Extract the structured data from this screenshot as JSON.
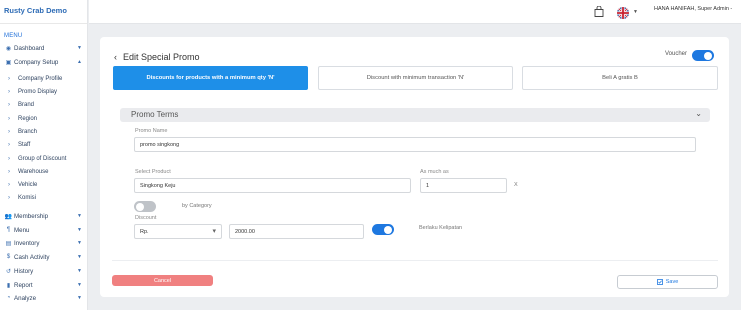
{
  "app": {
    "brand": "Rusty Crab Demo"
  },
  "sidebar": {
    "menu_title": "MENU",
    "items": [
      {
        "label": "Dashboard",
        "icon": "dashboard-icon"
      },
      {
        "label": "Company Setup",
        "icon": "company-icon"
      },
      {
        "label": "Membership",
        "icon": "users-icon"
      },
      {
        "label": "Menu",
        "icon": "menu-icon"
      },
      {
        "label": "Inventory",
        "icon": "inventory-icon"
      },
      {
        "label": "Cash Activity",
        "icon": "cash-icon"
      },
      {
        "label": "History",
        "icon": "history-icon"
      },
      {
        "label": "Report",
        "icon": "report-icon"
      },
      {
        "label": "Analyze",
        "icon": "analyze-icon"
      }
    ],
    "sub_items": [
      "Company Profile",
      "Promo Display",
      "Brand",
      "Region",
      "Branch",
      "Staff",
      "Group of Discount",
      "Warehouse",
      "Vehicle",
      "Komisi"
    ]
  },
  "topbar": {
    "user": "HANA HANIFAH, Super Admin -"
  },
  "page": {
    "title": "Edit Special Promo",
    "voucher_label": "Voucher",
    "voucher_on": true,
    "tabs": [
      {
        "label": "Discounts for products with a minimum qty 'N'",
        "active": true
      },
      {
        "label": "Discount with minimum transaction 'N'",
        "active": false
      },
      {
        "label": "Beli A gratis B",
        "active": false
      }
    ],
    "section_title": "Promo Terms",
    "promo_name_label": "Promo Name",
    "promo_name_value": "promo singkong",
    "select_product_label": "Select Product",
    "select_product_value": "Singkong Keju",
    "as_much_as_label": "As much as",
    "as_much_as_value": "1",
    "times_symbol": "X",
    "by_category_label": "by Category",
    "by_category_on": false,
    "discount_label": "Discount",
    "discount_unit": "Rp.",
    "discount_value": "2000.00",
    "multiple_on": true,
    "multiple_label": "Berlaku Kelipatan",
    "cancel_label": "Cancel",
    "save_label": "Save"
  },
  "colors": {
    "accent": "#1e8fe8",
    "cancel": "#f08080",
    "brand": "#2d6bb5"
  }
}
